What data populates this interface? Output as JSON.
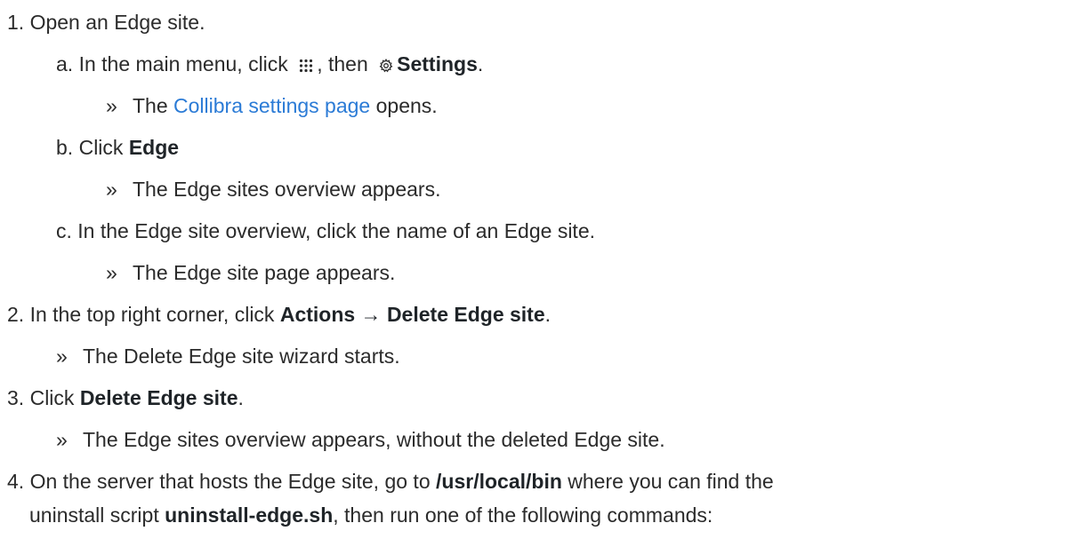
{
  "steps": [
    {
      "num": "1.",
      "text": "Open an Edge site."
    },
    {
      "num": "2.",
      "text_before": "In the top right corner, click",
      "bold": "Actions → Delete Edge site",
      "text_after": ".",
      "result": "The Delete Edge site wizard starts."
    },
    {
      "num": "3.",
      "text_before": "Click",
      "bold": "Delete Edge site",
      "text_after": ".",
      "result": "The Edge sites overview appears, without the deleted Edge site."
    },
    {
      "num": "4.",
      "line1_before": "On the server that hosts the Edge site, go to",
      "line1_bold": "/usr/local/bin",
      "line1_after": "where you can find the",
      "line2_before": "uninstall script",
      "line2_bold": "uninstall-edge.sh",
      "line2_after": ", then run one of the following commands:"
    }
  ],
  "substeps": [
    {
      "letter": "a.",
      "text_before": "In the main menu, click",
      "text_mid": ", then",
      "bold": "Settings",
      "text_after": ".",
      "result_before": "The",
      "result_link": "Collibra settings page",
      "result_after": "opens."
    },
    {
      "letter": "b.",
      "text_before": "Click",
      "bold": "Edge",
      "result": "The Edge sites overview appears."
    },
    {
      "letter": "c.",
      "text": "In the Edge site overview, click the name of an Edge site.",
      "result": "The Edge site page appears."
    }
  ],
  "bullet": "»",
  "icons": [
    "apps-grid-icon",
    "gear-icon"
  ],
  "colors": {
    "text": "#2b2b2b",
    "bold": "#1f2428",
    "link": "#2b7bd6"
  }
}
